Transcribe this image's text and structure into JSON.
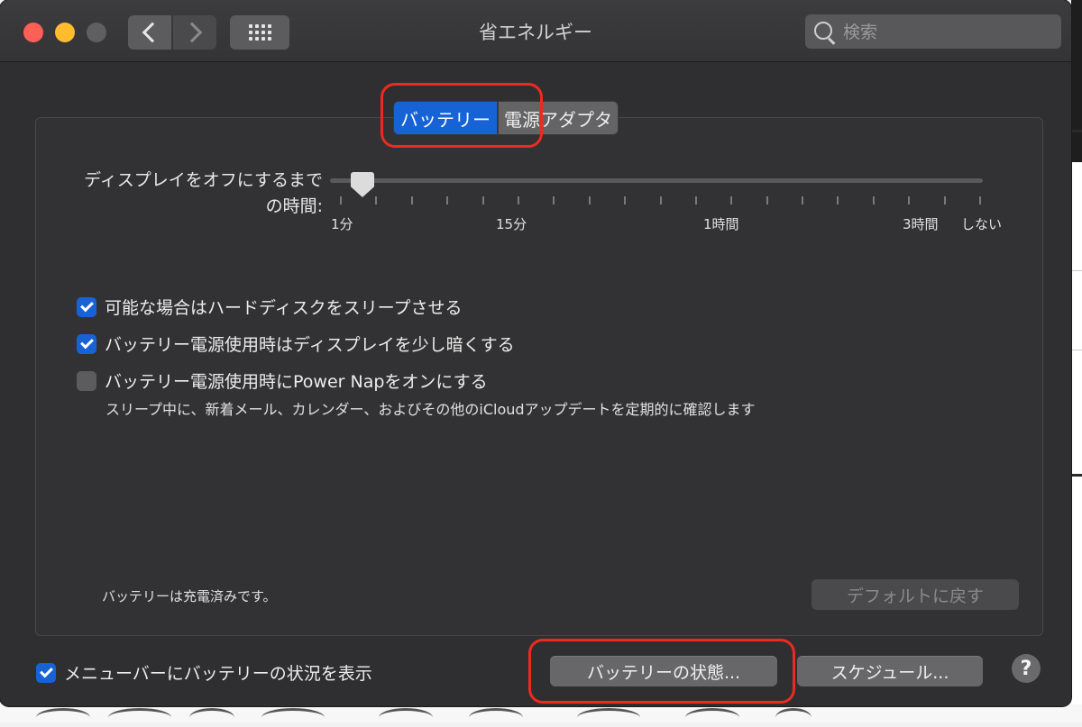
{
  "window": {
    "title": "省エネルギー"
  },
  "toolbar": {
    "search_placeholder": "検索"
  },
  "tabs": [
    {
      "label": "バッテリー",
      "active": true
    },
    {
      "label": "電源アダプタ",
      "active": false
    }
  ],
  "display_sleep": {
    "label_line1": "ディスプレイをオフにするまで",
    "label_line2": "の時間:",
    "tick_labels": [
      "1分",
      "15分",
      "1時間",
      "3時間",
      "しない"
    ],
    "value": "1分"
  },
  "options": [
    {
      "label": "可能な場合はハードディスクをスリープさせる",
      "checked": true
    },
    {
      "label": "バッテリー電源使用時はディスプレイを少し暗くする",
      "checked": true
    },
    {
      "label": "バッテリー電源使用時にPower Napをオンにする",
      "checked": false
    }
  ],
  "power_nap_description": "スリープ中に、新着メール、カレンダー、およびその他のiCloudアップデートを定期的に確認します",
  "status": "バッテリーは充電済みです。",
  "buttons": {
    "restore_defaults": "デフォルトに戻す",
    "battery_status": "バッテリーの状態...",
    "schedule": "スケジュール..."
  },
  "menubar_option": {
    "label": "メニューバーにバッテリーの状況を表示",
    "checked": true
  },
  "help_label": "?",
  "colors": {
    "accent": "#1763d6",
    "highlight": "#ee2a1f",
    "window_bg": "#2f2f31"
  }
}
